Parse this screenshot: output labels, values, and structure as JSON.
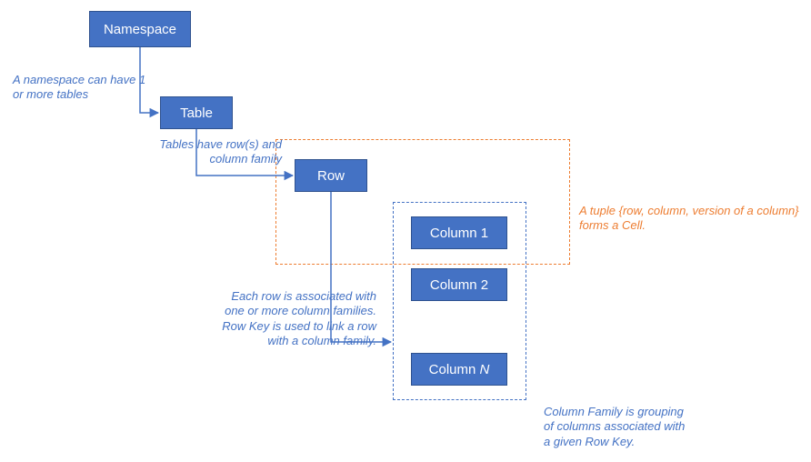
{
  "chart_data": {
    "type": "diagram",
    "title": "",
    "nodes": [
      {
        "id": "namespace",
        "label": "Namespace"
      },
      {
        "id": "table",
        "label": "Table"
      },
      {
        "id": "row",
        "label": "Row"
      },
      {
        "id": "column1",
        "label": "Column 1"
      },
      {
        "id": "column2",
        "label": "Column 2"
      },
      {
        "id": "columnN",
        "label": "Column N",
        "italic_part": "N"
      }
    ],
    "groups": [
      {
        "id": "cell_group",
        "members": [
          "row",
          "column1"
        ],
        "style": "orange-dashed"
      },
      {
        "id": "column_family_group",
        "members": [
          "column1",
          "column2",
          "columnN"
        ],
        "style": "blue-dashed"
      }
    ],
    "edges": [
      {
        "from": "namespace",
        "to": "table",
        "label_id": "ann_namespace"
      },
      {
        "from": "table",
        "to": "row",
        "label_id": "ann_table"
      },
      {
        "from": "row",
        "to": "column_family_group",
        "label_id": "ann_row"
      }
    ],
    "annotations": {
      "ann_namespace": "A namespace can have 1 or more tables",
      "ann_table": "Tables have row(s) and column family",
      "ann_row_l1": "Each row is associated with",
      "ann_row_l2": "one or more column families.",
      "ann_row_l3": "Row Key is used to link a row",
      "ann_row_l4": "with a column family.",
      "ann_cell_l1": "A tuple {row, column, version of a column}",
      "ann_cell_l2": "forms a Cell.",
      "ann_cf_l1": "Column Family is grouping",
      "ann_cf_l2": "of columns associated with",
      "ann_cf_l3": "a given Row Key."
    }
  },
  "labels": {
    "namespace": "Namespace",
    "table": "Table",
    "row": "Row",
    "column1": "Column 1",
    "column2": "Column 2",
    "columnN_prefix": "Column ",
    "columnN_suffix": "N"
  }
}
